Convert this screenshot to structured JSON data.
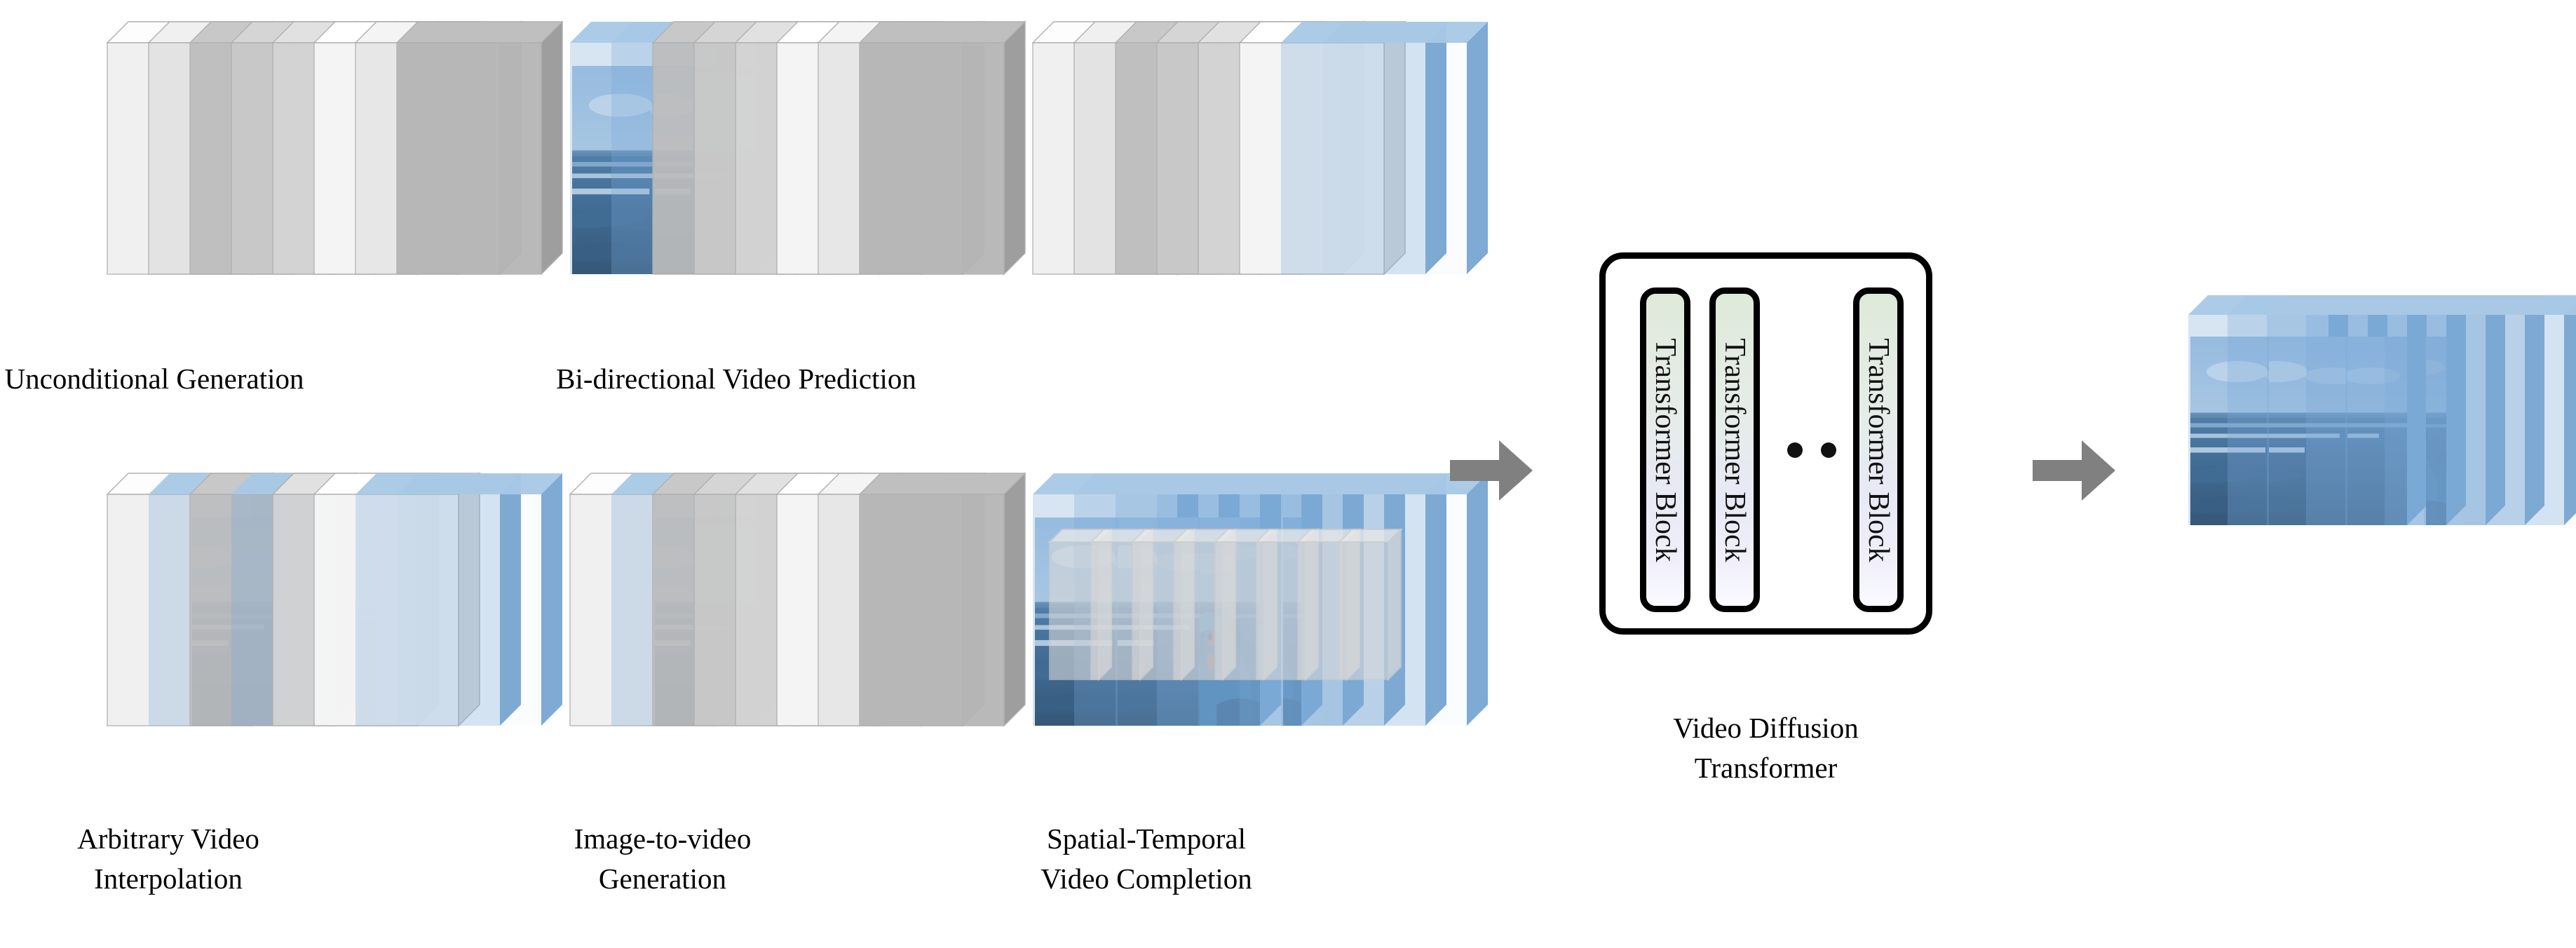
{
  "figure": {
    "type": "architecture-diagram",
    "background_color": "#ffffff",
    "arrow_color": "#808080",
    "frame_gray_colors": [
      "#efefef",
      "#e2e2e2",
      "#bdbdbd",
      "#c9c9c9",
      "#d4d4d4",
      "#f7f7f7",
      "#e6e6e6",
      "#b4b4b4"
    ],
    "frame_edge_color": "#b0b0b0",
    "image_frame_tint": "#7aa8d8",
    "mask_box_color": "#d0d0d0"
  },
  "tasks": [
    {
      "id": "unconditional-generation",
      "label": "Unconditional Generation",
      "frame_count": 8,
      "frame_types": [
        "gray",
        "gray",
        "gray",
        "gray",
        "gray",
        "gray",
        "gray",
        "gray"
      ]
    },
    {
      "id": "bidirectional-video-prediction",
      "label": "Bi-directional Video Prediction",
      "frame_count": 8,
      "frame_types": [
        "image",
        "image",
        "gray",
        "gray",
        "gray",
        "gray",
        "gray",
        "gray"
      ]
    },
    {
      "id": "image-to-video-generation",
      "label": "Image-to-video\nGeneration",
      "frame_count": 8,
      "frame_types": [
        "gray",
        "image",
        "gray",
        "gray",
        "gray",
        "gray",
        "gray",
        "gray"
      ]
    },
    {
      "id": "arbitrary-video-interpolation",
      "label": "Arbitrary Video\nInterpolation",
      "frame_count": 8,
      "frame_types": [
        "gray",
        "image",
        "gray",
        "image",
        "gray",
        "gray",
        "image",
        "image"
      ]
    },
    {
      "id": "bidirectional-video-prediction-end",
      "label": "Bi-directional Video Prediction",
      "frame_count": 8,
      "frame_types": [
        "gray",
        "gray",
        "gray",
        "gray",
        "gray",
        "gray",
        "image",
        "image"
      ]
    },
    {
      "id": "spatial-temporal-video-completion",
      "label": "Spatial-Temporal\nVideo Completion",
      "frame_count": 8,
      "frame_types": [
        "image",
        "image",
        "image",
        "image",
        "image",
        "image",
        "image",
        "image"
      ],
      "has_mask_overlay": true,
      "mask_count": 8
    }
  ],
  "model": {
    "container_name": "Video Diffusion Transformer",
    "caption": "Video Diffusion\nTransformer",
    "blocks": [
      {
        "label": "Transformer Block"
      },
      {
        "label": "Transformer Block"
      },
      {
        "label": "Transformer Block"
      }
    ],
    "ellipsis": "• • •",
    "block_gradient_top": "#dfeada",
    "block_gradient_bottom": "#fafaff",
    "border_color": "#000000"
  },
  "output": {
    "id": "generated-video",
    "frame_count": 8,
    "frame_types": [
      "image",
      "image",
      "image",
      "image",
      "image",
      "image",
      "image",
      "image"
    ]
  },
  "arrows": [
    {
      "id": "input-to-model",
      "direction": "right",
      "color": "#808080"
    },
    {
      "id": "model-to-output",
      "direction": "right",
      "color": "#808080"
    }
  ],
  "scene": {
    "description": "ocean wave with surfer",
    "sky_color": "#b8d0e8",
    "horizon_color": "#6f9ec4",
    "sea_color": "#2f5c86",
    "deep_sea_color": "#1d3f63",
    "foam_color": "#f2f6f8",
    "wave_face_color": "#5d90b0",
    "surfer_color": "#d4572a"
  }
}
